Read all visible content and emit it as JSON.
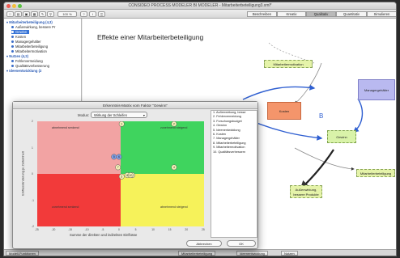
{
  "window": {
    "title": "CONSIDEO PROCESS MODELER BI MODELER - Mitarbeiterbeteiligung3.xml*"
  },
  "toolbar": {
    "zoom": "100 %",
    "tabs": [
      "Beschreiben",
      "Kreativ",
      "Qualitativ",
      "Quantitativ",
      "Simulieren"
    ],
    "active_tab": "Qualitativ"
  },
  "sidebar": {
    "items": [
      {
        "label": "Mitarbeiterbeteiligung (4,3)",
        "level": 0
      },
      {
        "label": "Außenwirkung, bessere Pr",
        "level": 1
      },
      {
        "label": "Gewinn",
        "level": 1,
        "selected": true
      },
      {
        "label": "Kosten",
        "level": 1
      },
      {
        "label": "Managergehälter",
        "level": 1
      },
      {
        "label": "Mitarbeiterbeteiligung",
        "level": 1
      },
      {
        "label": "Mitarbeitermotivation",
        "level": 1
      },
      {
        "label": "Nutzen (4,2)",
        "level": 0
      },
      {
        "label": "Fehlervermeidung",
        "level": 1
      },
      {
        "label": "Qualitätsverbesserung",
        "level": 1
      },
      {
        "label": "Ideenentwicklung (2",
        "level": 0
      }
    ]
  },
  "canvas": {
    "title": "Effekte einer Mitarbeiterbeteiligung",
    "nodes": {
      "mitarbeitermotivation": "Mitarbeitermotivation",
      "managergehaelter": "Managergehälter",
      "kosten": "Kosten",
      "gewinn": "Gewinn",
      "mitarbeiterbeteiligung": "Mitarbeiterbeteiligung",
      "aussenwirkung": "Außenwirkung, bessere Produkte"
    },
    "loop_label": "B",
    "colors": {
      "kosten": "#f4956b",
      "managergehaelter": "#b9b9f0",
      "gewinn": "#d9f3a9",
      "motivation": "#e5f3a9"
    }
  },
  "dialog": {
    "title": "Erkenntnis-Matrix vom Faktor \"Gewinn\"",
    "modus_label": "Modus:",
    "modus_value": "Wirkung der Schleifen",
    "y_axis_label": "Einflussänderung je Zeiteinheit",
    "x_axis_label": "Summe der direkten und indirekten Einflüsse",
    "quadrants": {
      "top_left": "abnehmend senkend",
      "top_right": "zunehmend steigend",
      "bottom_left": "zunehmend senkend",
      "bottom_right": "abnehmend steigend"
    },
    "x_ticks": [
      "-25",
      "-20",
      "-15",
      "-10",
      "-5",
      "0",
      "5",
      "10",
      "15",
      "20",
      "25"
    ],
    "y_ticks": [
      "2",
      "1",
      "0",
      "-1",
      "-2"
    ],
    "list": [
      "1. Außenwirkung, besse",
      "2. Fehlervermeidung",
      "3. Forschungsbudget",
      "4. Gewinn",
      "5. Ideenentwicklung",
      "6. Kosten",
      "7. Managergehälter",
      "8. Mitarbeiterbeteiligung",
      "9. Mitarbeitermotivation",
      "10. Qualitätsverbessern"
    ],
    "points": [
      {
        "label": "1",
        "x": 0.3,
        "y": 1.9
      },
      {
        "label": "2",
        "x": 16,
        "y": 1.9
      },
      {
        "label": "5",
        "x": -2,
        "y": 0.65
      },
      {
        "label": "6",
        "x": -0.5,
        "y": 0.65
      },
      {
        "label": "7",
        "x": -0.8,
        "y": 0.25
      },
      {
        "label": "8",
        "x": 2,
        "y": -0.05
      },
      {
        "label": "9",
        "x": 3.5,
        "y": -0.05
      },
      {
        "label": "10",
        "x": 3,
        "y": -0.05
      },
      {
        "label": "3",
        "x": 0.3,
        "y": -0.1
      },
      {
        "label": "4",
        "x": 16,
        "y": 0.25
      }
    ],
    "cancel_label": "Abbrechen",
    "ok_label": "OK"
  },
  "statusbar": {
    "left_label": "Modell-Funktionen",
    "tabs": [
      "Mitarbeiterbeteiligung",
      "Ideenentwicklung",
      "Nutzen"
    ]
  }
}
